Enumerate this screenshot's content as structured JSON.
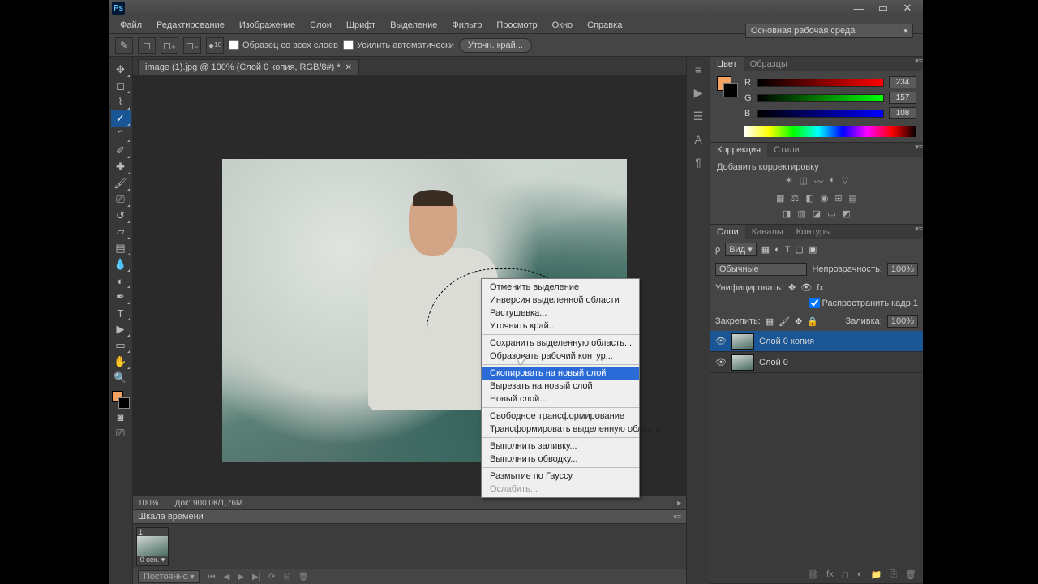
{
  "titlebar": {
    "logo": "Ps"
  },
  "menu": {
    "items": [
      "Файл",
      "Редактирование",
      "Изображение",
      "Слои",
      "Шрифт",
      "Выделение",
      "Фильтр",
      "Просмотр",
      "Окно",
      "Справка"
    ]
  },
  "options": {
    "brush_size": "10",
    "sample_all_label": "Образец со всех слоев",
    "auto_enhance_label": "Усилить автоматически",
    "refine_btn": "Уточн. край..."
  },
  "workspace_selector": "Основная рабочая среда",
  "document": {
    "tab_title": "image (1).jpg @ 100% (Слой 0 копия, RGB/8#) *"
  },
  "status": {
    "zoom": "100%",
    "doc_info": "Док: 900,0К/1,76М"
  },
  "timeline": {
    "header": "Шкала времени",
    "frame_label": "1",
    "frame_duration": "0 сек. ▾",
    "loop_mode": "Постоянно"
  },
  "panels": {
    "color": {
      "tab1": "Цвет",
      "tab2": "Образцы",
      "r_label": "R",
      "g_label": "G",
      "b_label": "B",
      "r": "234",
      "g": "157",
      "b": "108"
    },
    "adjust": {
      "tab1": "Коррекция",
      "tab2": "Стили",
      "hint": "Добавить корректировку"
    },
    "layers": {
      "tab1": "Слои",
      "tab2": "Каналы",
      "tab3": "Контуры",
      "kind_label": "Вид",
      "blend_mode": "Обычные",
      "opacity_label": "Непрозрачность:",
      "opacity_val": "100%",
      "unify_label": "Унифицировать:",
      "propagate_label": "Распространить кадр 1",
      "lock_label": "Закрепить:",
      "fill_label": "Заливка:",
      "fill_val": "100%",
      "layer0copy": "Слой 0 копия",
      "layer0": "Слой 0"
    }
  },
  "contextmenu": {
    "items": [
      {
        "t": "Отменить выделение",
        "d": false
      },
      {
        "t": "Инверсия выделенной области",
        "d": false
      },
      {
        "t": "Растушевка...",
        "d": false
      },
      {
        "t": "Уточнить край...",
        "d": false
      }
    ],
    "grp2": [
      {
        "t": "Сохранить выделенную область...",
        "d": false
      },
      {
        "t": "Образовать рабочий контур...",
        "d": false
      }
    ],
    "grp3": [
      {
        "t": "Скопировать на новый слой",
        "d": false,
        "hl": true
      },
      {
        "t": "Вырезать на новый слой",
        "d": false
      },
      {
        "t": "Новый слой...",
        "d": false
      }
    ],
    "grp4": [
      {
        "t": "Свободное трансформирование",
        "d": false
      },
      {
        "t": "Трансформировать выделенную область",
        "d": false
      }
    ],
    "grp5": [
      {
        "t": "Выполнить заливку...",
        "d": false
      },
      {
        "t": "Выполнить обводку...",
        "d": false
      }
    ],
    "grp6": [
      {
        "t": "Размытие по Гауссу",
        "d": false
      },
      {
        "t": "Ослабить...",
        "d": true
      }
    ]
  }
}
